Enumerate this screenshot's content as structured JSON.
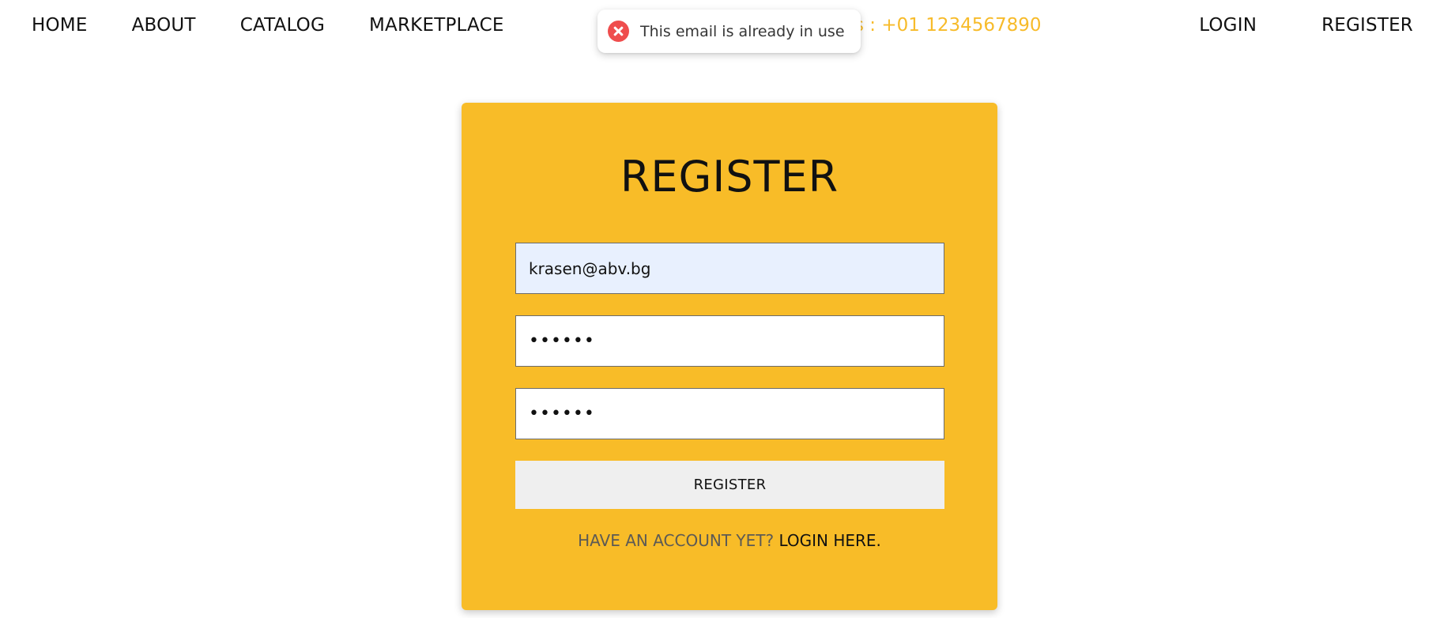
{
  "nav": {
    "left": [
      "HOME",
      "ABOUT",
      "CATALOG",
      "MARKETPLACE"
    ],
    "contact_partial": "s : +01 1234567890",
    "right": [
      "LOGIN",
      "REGISTER"
    ]
  },
  "toast": {
    "icon": "error-x-icon",
    "message": "This email is already in use",
    "color": "#ef4d4d"
  },
  "form": {
    "title": "REGISTER",
    "email_value": "krasen@abv.bg",
    "password_value": "••••••",
    "repeat_password_value": "••••••",
    "submit_label": "REGISTER",
    "footer_prompt": "HAVE AN ACCOUNT YET?",
    "footer_link": "LOGIN HERE."
  },
  "colors": {
    "accent": "#f8bc28",
    "autofill": "#e8f0fe",
    "button": "#efefef"
  }
}
